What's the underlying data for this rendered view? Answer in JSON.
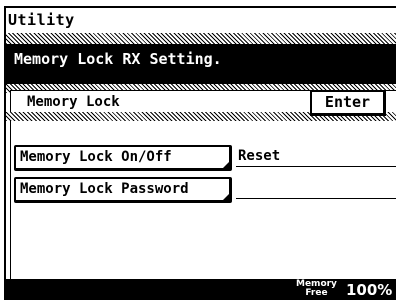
{
  "window": {
    "title": "Utility"
  },
  "message": {
    "text": "Memory Lock RX Setting."
  },
  "header": {
    "label": "Memory Lock",
    "enter_label": "Enter"
  },
  "items": [
    {
      "label": "Memory Lock On/Off",
      "value": "Reset"
    },
    {
      "label": "Memory Lock Password",
      "value": ""
    }
  ],
  "status": {
    "memory_line1": "Memory",
    "memory_line2": "Free",
    "memory_percent": "100%"
  },
  "colors": {
    "background": "#ffffff",
    "foreground": "#000000"
  }
}
